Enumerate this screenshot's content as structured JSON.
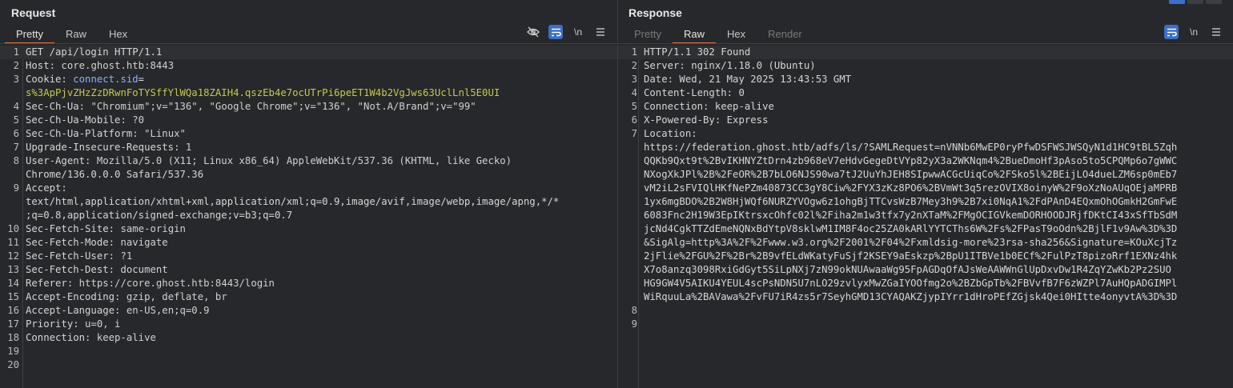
{
  "request": {
    "title": "Request",
    "tabs": [
      {
        "label": "Pretty",
        "active": true
      },
      {
        "label": "Raw",
        "active": false
      },
      {
        "label": "Hex",
        "active": false
      }
    ],
    "newline_label": "\\n",
    "lines": [
      {
        "n": "1",
        "text": "GET /api/login HTTP/1.1"
      },
      {
        "n": "2",
        "name": "Host:",
        "value": " core.ghost.htb:8443"
      },
      {
        "n": "3",
        "text": "Cookie: connect.sid="
      },
      {
        "n": "",
        "text": "s%3ApPjvZHzZzDRwnFoTYSffYlWQa18ZAIH4.qszEb4e7ocUTrPi6peET1W4b2VgJws63UclLnl5E0UI"
      },
      {
        "n": "4",
        "name": "Sec-Ch-Ua:",
        "value": " \"Chromium\";v=\"136\", \"Google Chrome\";v=\"136\", \"Not.A/Brand\";v=\"99\""
      },
      {
        "n": "5",
        "name": "Sec-Ch-Ua-Mobile:",
        "value": " ?0"
      },
      {
        "n": "6",
        "name": "Sec-Ch-Ua-Platform:",
        "value": " \"Linux\""
      },
      {
        "n": "7",
        "name": "Upgrade-Insecure-Requests:",
        "value": " 1"
      },
      {
        "n": "8",
        "name": "User-Agent:",
        "value": " Mozilla/5.0 (X11; Linux x86_64) AppleWebKit/537.36 (KHTML, like Gecko)"
      },
      {
        "n": "",
        "text": "Chrome/136.0.0.0 Safari/537.36"
      },
      {
        "n": "9",
        "name": "Accept:",
        "value": ""
      },
      {
        "n": "",
        "text": "text/html,application/xhtml+xml,application/xml;q=0.9,image/avif,image/webp,image/apng,*/*"
      },
      {
        "n": "",
        "text": ";q=0.8,application/signed-exchange;v=b3;q=0.7"
      },
      {
        "n": "10",
        "name": "Sec-Fetch-Site:",
        "value": " same-origin"
      },
      {
        "n": "11",
        "name": "Sec-Fetch-Mode:",
        "value": " navigate"
      },
      {
        "n": "12",
        "name": "Sec-Fetch-User:",
        "value": " ?1"
      },
      {
        "n": "13",
        "name": "Sec-Fetch-Dest:",
        "value": " document"
      },
      {
        "n": "14",
        "name": "Referer:",
        "value": " https://core.ghost.htb:8443/login"
      },
      {
        "n": "15",
        "name": "Accept-Encoding:",
        "value": " gzip, deflate, br"
      },
      {
        "n": "16",
        "name": "Accept-Language:",
        "value": " en-US,en;q=0.9"
      },
      {
        "n": "17",
        "name": "Priority:",
        "value": " u=0, i"
      },
      {
        "n": "18",
        "name": "Connection:",
        "value": " keep-alive"
      },
      {
        "n": "19",
        "text": ""
      },
      {
        "n": "20",
        "text": ""
      }
    ]
  },
  "response": {
    "title": "Response",
    "tabs": [
      {
        "label": "Pretty",
        "active": false,
        "disabled": true
      },
      {
        "label": "Raw",
        "active": true
      },
      {
        "label": "Hex",
        "active": false
      },
      {
        "label": "Render",
        "active": false,
        "disabled": true
      }
    ],
    "newline_label": "\\n",
    "lines": [
      {
        "n": "1",
        "text": "HTTP/1.1 302 Found"
      },
      {
        "n": "2",
        "text": "Server: nginx/1.18.0 (Ubuntu)"
      },
      {
        "n": "3",
        "text": "Date: Wed, 21 May 2025 13:43:53 GMT"
      },
      {
        "n": "4",
        "text": "Content-Length: 0"
      },
      {
        "n": "5",
        "text": "Connection: keep-alive"
      },
      {
        "n": "6",
        "text": "X-Powered-By: Express"
      },
      {
        "n": "7",
        "text": "Location:"
      },
      {
        "n": "",
        "text": "https://federation.ghost.htb/adfs/ls/?SAMLRequest=nVNNb6MwEP0ryPfwDSFWSJWSQyN1d1HC9tBL5Zqh"
      },
      {
        "n": "",
        "text": "QQKb9Qxt9t%2BvIKHNYZtDrn4zb968eV7eHdvGegeDtVYp82yX3a2WKNqm4%2BueDmoHf3pAso5to5CPQMp6o7gWWC"
      },
      {
        "n": "",
        "text": "NXogXkJPl%2B%2FeOR%2B7bLO6NJS90wa7tJ2UuYhJEH8SIpwwACGcUiqCo%2FSko5l%2BEijLO4dueLZM6sp0mEb7"
      },
      {
        "n": "",
        "text": "vM2iL2sFVIQlHKfNePZm40873CC3gY8Ciw%2FYX3zKz8PO6%2BVmWt3q5rezOVIX8oinyW%2F9oXzNoAUqOEjaMPRB"
      },
      {
        "n": "",
        "text": "1yx6mgBDO%2B2W8HjWQf6NURZYVOgw6z1ohgBjTTCvsWzB7Mey3h9%2B7xi0NqA1%2FdPAnD4EQxmOhOGmkH2GmFwE"
      },
      {
        "n": "",
        "text": "6083Fnc2H19W3EpIKtrsxcOhfc02l%2Fiha2m1w3tfx7y2nXTaM%2FMgOCIGVkemDORHOODJRjfDKtCI43xSfTbSdM"
      },
      {
        "n": "",
        "text": "jcNd4CgkTTZdEmeNQNxBdYtpV8sklwM1IM8F4oc25ZA0kARlYYTCThs6W%2Fs%2FPasT9oOdn%2BjlF1v9Aw%3D%3D"
      },
      {
        "n": "",
        "text": "&SigAlg=http%3A%2F%2Fwww.w3.org%2F2001%2F04%2Fxmldsig-more%23rsa-sha256&Signature=KOuXcjTz"
      },
      {
        "n": "",
        "text": "2jFlie%2FGU%2F%2Br%2B9vfELdWKatyFuSjf2KSEY9aEskzp%2BpU1ITBVe1b0ECf%2FulPzT8pizoRrf1EXNz4hk"
      },
      {
        "n": "",
        "text": "X7o8anzq3098RxiGdGyt5SiLpNXj7zN99okNUAwaaWg95FpAGDqOfAJsWeAAWWnGlUpDxvDw1R4ZqYZwKb2Pz2SUO"
      },
      {
        "n": "",
        "text": "HG9GW4V5AIKU4YEUL4scPsNDN5U7nLO29zvlyxMwZGaIYOOfmg2o%2BZbGpTb%2FBVvfB7F6zWZPl7AuHQpADGIMPl"
      },
      {
        "n": "",
        "text": "WiRquuLa%2BAVawa%2FvFU7iR4zs5r7SeyhGMD13CYAQAKZjypIYrr1dHroPEfZGjsk4Qei0HItte4onyvtA%3D%3D"
      },
      {
        "n": "",
        "text": ""
      },
      {
        "n": "8",
        "text": ""
      },
      {
        "n": "9",
        "text": ""
      }
    ]
  }
}
